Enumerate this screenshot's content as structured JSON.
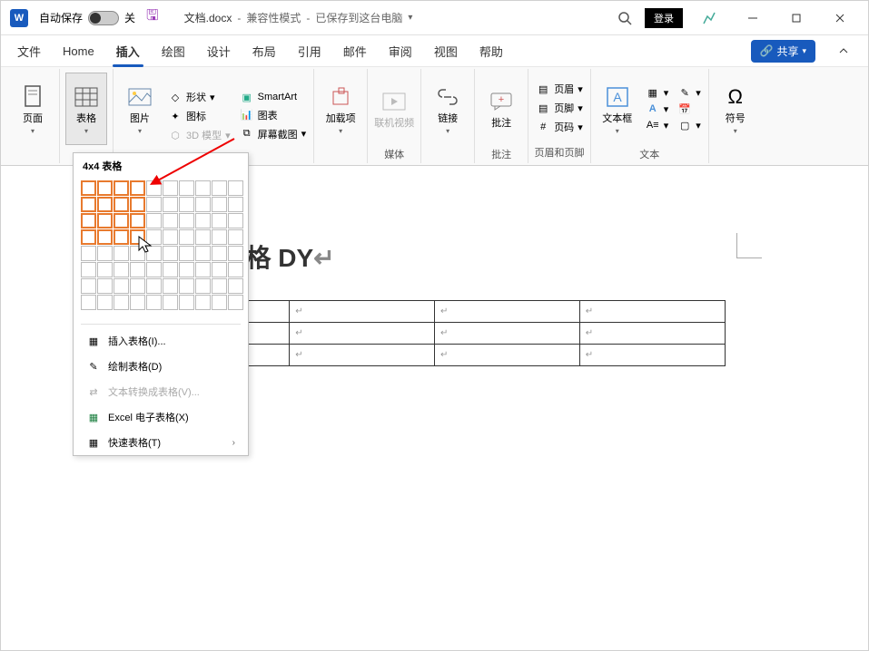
{
  "titlebar": {
    "autosave_label": "自动保存",
    "toggle_state": "关",
    "filename": "文档.docx",
    "mode": "兼容性模式",
    "saved_status": "已保存到这台电脑",
    "login": "登录"
  },
  "tabs": {
    "file": "文件",
    "home": "Home",
    "insert": "插入",
    "draw": "绘图",
    "design": "设计",
    "layout": "布局",
    "references": "引用",
    "mail": "邮件",
    "review": "审阅",
    "view": "视图",
    "help": "帮助",
    "share": "共享"
  },
  "ribbon": {
    "pages_group": "页面",
    "table": "表格",
    "picture": "图片",
    "shapes": "形状",
    "icons": "图标",
    "smartart": "SmartArt",
    "chart": "图表",
    "model3d": "3D 模型",
    "screenshot": "屏幕截图",
    "addins": "加载项",
    "media": "媒体",
    "online_video": "联机视频",
    "links": "链接",
    "comments": "批注",
    "comments_group": "批注",
    "header": "页眉",
    "footer": "页脚",
    "page_number": "页码",
    "header_footer_group": "页眉和页脚",
    "text_box": "文本框",
    "text_group": "文本",
    "symbol": "符号"
  },
  "table_menu": {
    "title": "4x4 表格",
    "insert_table": "插入表格(I)...",
    "draw_table": "绘制表格(D)",
    "convert_text": "文本转换成表格(V)...",
    "excel": "Excel 电子表格(X)",
    "quick_table": "快速表格(T)",
    "selected_rows": 4,
    "selected_cols": 4,
    "grid_rows": 8,
    "grid_cols": 10
  },
  "document": {
    "heading": "怎么做表格 DY",
    "table_rows": 3,
    "table_cols": 4,
    "cell_placeholder": "↵"
  }
}
